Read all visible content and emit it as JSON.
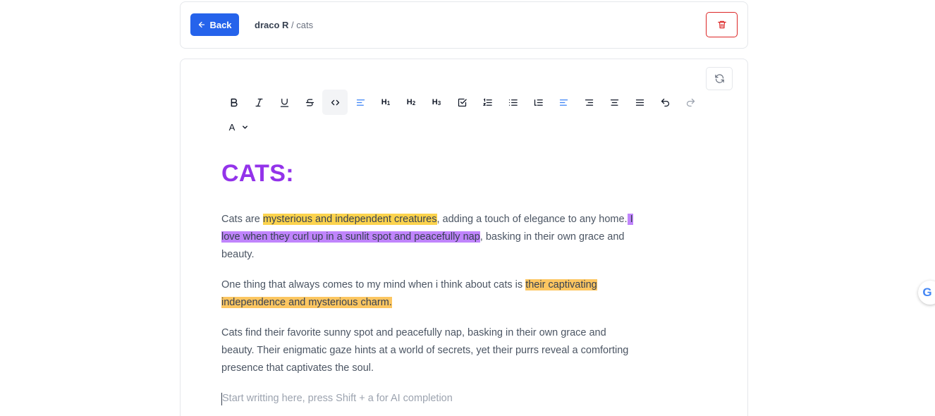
{
  "header": {
    "back_label": "Back",
    "breadcrumb_owner": "draco R",
    "breadcrumb_separator": " / ",
    "breadcrumb_page": "cats"
  },
  "toolbar": {
    "buttons": [
      "bold",
      "italic",
      "underline",
      "strikethrough",
      "code",
      "align-left",
      "heading-1",
      "heading-2",
      "heading-3",
      "task-list",
      "ordered-list",
      "bullet-list",
      "indent-list",
      "align-left",
      "align-right",
      "align-center",
      "justify",
      "undo",
      "redo"
    ],
    "active_button": "code",
    "h1_label": "H",
    "h1_sub": "1",
    "h2_label": "H",
    "h2_sub": "2",
    "h3_label": "H",
    "h3_sub": "3",
    "color_label": "A"
  },
  "document": {
    "title": "CATS:",
    "p1": {
      "t1": "Cats are ",
      "hl1": "mysterious and independent creatures",
      "t2": ", adding a touch of elegance to any home.",
      "hl2": " I love when they curl up in a sunlit spot and peacefully nap",
      "t3": ", basking in their own grace and beauty."
    },
    "p2": {
      "t1": "One thing that always comes to my mind when i think about cats is ",
      "hl1": "their captivating independence and mysterious charm."
    },
    "p3": "Cats find their favorite sunny spot and peacefully nap, basking in their own grace and beauty. Their enigmatic gaze hints at a world of secrets, yet their purrs reveal a comforting presence that captivates the soul.",
    "placeholder": "Start writting here, press Shift + a for AI completion"
  },
  "colors": {
    "primary": "#2563eb",
    "danger": "#dc2626",
    "title": "#9333ea",
    "highlight_yellow": "#fcd34d",
    "highlight_purple": "#c084fc",
    "highlight_orange": "#fcc661"
  },
  "icons": [
    "arrow-left-icon",
    "trash-icon",
    "refresh-icon",
    "chevron-down-icon",
    "google-icon"
  ],
  "floating": {
    "google_glyph": "G"
  }
}
